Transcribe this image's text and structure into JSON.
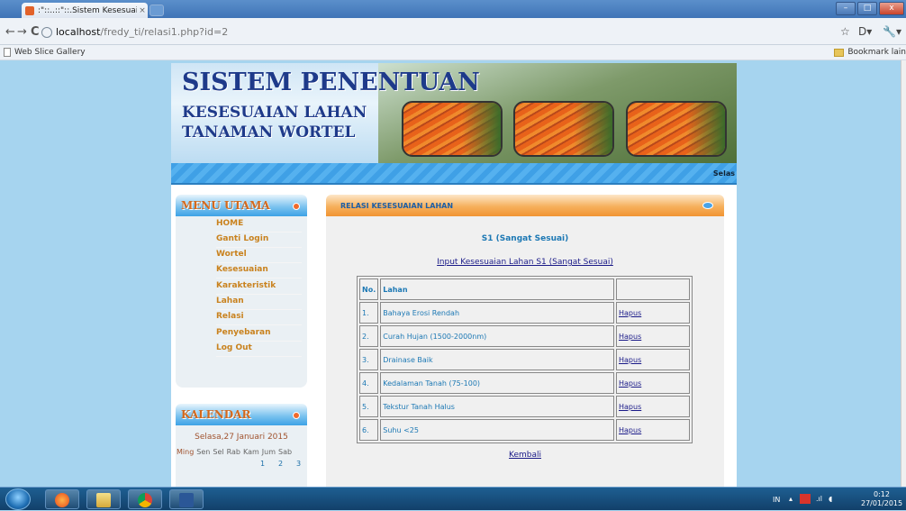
{
  "browser": {
    "tab_title": ":\"::..::\"::.Sistem Kesesuaia...",
    "tab_close": "×",
    "url_host": "localhost",
    "url_path": "/fredy_ti/relasi1.php?id=2",
    "bookmark_left": "Web Slice Gallery",
    "bookmark_right": "Bookmark lain",
    "nav_back": "←",
    "nav_forward": "→",
    "nav_reload": "C",
    "star": "☆",
    "page_menu": "D▾",
    "wrench": "🔧▾",
    "win_min": "–",
    "win_max": "□",
    "win_close": "x"
  },
  "header": {
    "title_line1": "SISTEM PENENTUAN",
    "title_line2": "KESESUAIAN LAHAN",
    "title_line3": "TANAMAN WORTEL",
    "marquee": "Selas"
  },
  "sidebar": {
    "menu_title": "MENU UTAMA",
    "items": [
      {
        "label": "HOME"
      },
      {
        "label": "Ganti Login"
      },
      {
        "label": "Wortel"
      },
      {
        "label": "Kesesuaian"
      },
      {
        "label": "Karakteristik"
      },
      {
        "label": "Lahan"
      },
      {
        "label": "Relasi"
      },
      {
        "label": "Penyebaran"
      },
      {
        "label": "Log Out"
      }
    ],
    "calendar_title": "KALENDAR",
    "calendar_date": "Selasa,27 Januari 2015",
    "calendar_days": [
      "Ming",
      "Sen",
      "Sel",
      "Rab",
      "Kam",
      "Jum",
      "Sab"
    ],
    "calendar_first_row": [
      "1",
      "2",
      "3"
    ]
  },
  "main": {
    "panel_title": "RELASI KESESUAIAN LAHAN",
    "class_title": "S1 (Sangat Sesuai)",
    "input_link": "Input Kesesuaian Lahan S1 (Sangat Sesuai)",
    "table_headers": {
      "no": "No.",
      "lahan": "Lahan",
      "action": ""
    },
    "rows": [
      {
        "no": "1.",
        "lahan": "Bahaya Erosi Rendah",
        "action": "Hapus"
      },
      {
        "no": "2.",
        "lahan": "Curah Hujan (1500-2000nm)",
        "action": "Hapus"
      },
      {
        "no": "3.",
        "lahan": "Drainase Baik",
        "action": "Hapus"
      },
      {
        "no": "4.",
        "lahan": "Kedalaman Tanah (75-100)",
        "action": "Hapus"
      },
      {
        "no": "5.",
        "lahan": "Tekstur Tanah Halus",
        "action": "Hapus"
      },
      {
        "no": "6.",
        "lahan": "Suhu <25",
        "action": "Hapus"
      }
    ],
    "back_link": "Kembali"
  },
  "taskbar": {
    "lang": "IN",
    "time": "0:12",
    "date": "27/01/2015"
  }
}
